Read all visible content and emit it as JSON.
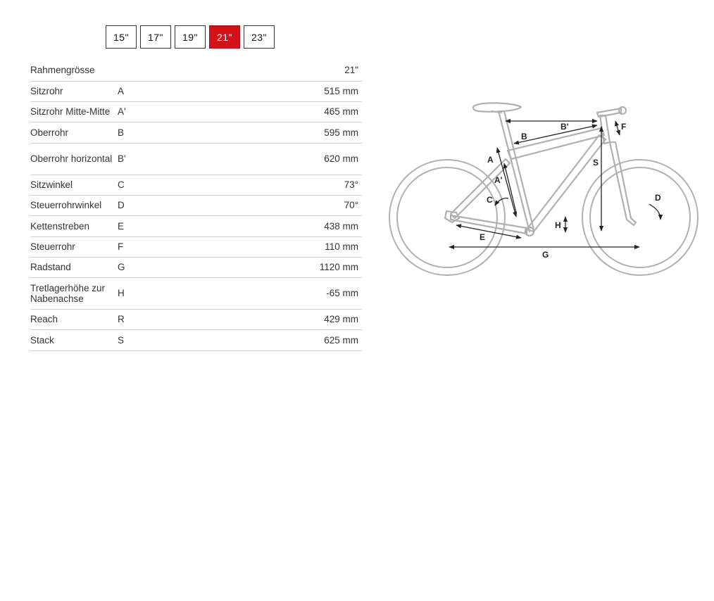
{
  "size_tabs": [
    {
      "label": "15\"",
      "active": false
    },
    {
      "label": "17\"",
      "active": false
    },
    {
      "label": "19\"",
      "active": false
    },
    {
      "label": "21\"",
      "active": true
    },
    {
      "label": "23\"",
      "active": false
    }
  ],
  "table": {
    "rows": [
      {
        "name": "Rahmengrösse",
        "code": "",
        "value": "21\""
      },
      {
        "name": "Sitzrohr",
        "code": "A",
        "value": "515 mm"
      },
      {
        "name": "Sitzrohr Mitte-Mitte",
        "code": "A'",
        "value": "465 mm"
      },
      {
        "name": "Oberrohr",
        "code": "B",
        "value": "595 mm"
      },
      {
        "name": "Oberrohr horizontal",
        "code": "B'",
        "value": "620 mm"
      },
      {
        "name": "Sitzwinkel",
        "code": "C",
        "value": "73°"
      },
      {
        "name": "Steuerrohrwinkel",
        "code": "D",
        "value": "70°"
      },
      {
        "name": "Kettenstreben",
        "code": "E",
        "value": "438 mm"
      },
      {
        "name": "Steuerrohr",
        "code": "F",
        "value": "110 mm"
      },
      {
        "name": "Radstand",
        "code": "G",
        "value": "1120 mm"
      },
      {
        "name": "Tretlagerhöhe zur Nabenachse",
        "code": "H",
        "value": "-65 mm"
      },
      {
        "name": "Reach",
        "code": "R",
        "value": "429 mm"
      },
      {
        "name": "Stack",
        "code": "S",
        "value": "625 mm"
      }
    ]
  },
  "diagram": {
    "labels": {
      "A": "A",
      "A_prime": "A'",
      "B": "B",
      "B_prime": "B'",
      "C": "C",
      "D": "D",
      "E": "E",
      "F": "F",
      "G": "G",
      "H": "H",
      "S": "S"
    },
    "frame_color": "#b0b0b0",
    "arrow_color": "#222222"
  }
}
